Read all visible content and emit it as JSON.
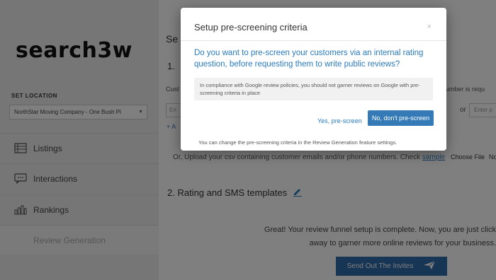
{
  "sidebar": {
    "logo": "search3w",
    "set_location_label": "SET LOCATION",
    "location_value": "NorthStar Moving Company - One Bush Pl",
    "items": [
      {
        "label": "Listings",
        "icon": "listings-icon"
      },
      {
        "label": "Interactions",
        "icon": "chat-icon"
      },
      {
        "label": "Rankings",
        "icon": "bar-chart-icon"
      },
      {
        "label": "Review Generation",
        "icon": "",
        "active": true
      }
    ]
  },
  "main": {
    "title": "Se",
    "step1": "1.",
    "customer_label": "Cust",
    "number_required": "number is requ",
    "input_left_placeholder": "En",
    "or_text": "or",
    "input_right_placeholder": "Enter p",
    "add_link": "+ A",
    "upload_text": "Or, Upload your csv containing customer emails and/or phone numbers. Check ",
    "upload_sample_link": "sample",
    "choose_file": "Choose File",
    "no_file": "No",
    "step2": "2.  Rating and SMS templates",
    "great_text": "Great! Your review funnel setup is complete. Now, you are just click away to garner more online reviews for your business.",
    "send_button": "Send Out The Invites"
  },
  "modal": {
    "title": "Setup pre-screening criteria",
    "close": "×",
    "question": "Do you want to pre-screen your customers via an internal rating question, before requesting them to write public reviews?",
    "notice": "In compliance with Google review policies, you should not garner reviews on Google with pre-screening criteria in place",
    "yes_button": "Yes, pre-screen",
    "no_button": "No, don't pre-screen",
    "footer": "You can change the pre-screening criteria in the Review Generation feature settings."
  },
  "colors": {
    "accent_blue": "#337ab7",
    "link_blue": "#2a7bbd",
    "send_button_bg": "#2e6aa8",
    "overlay": "rgba(0,0,0,0.5)"
  }
}
